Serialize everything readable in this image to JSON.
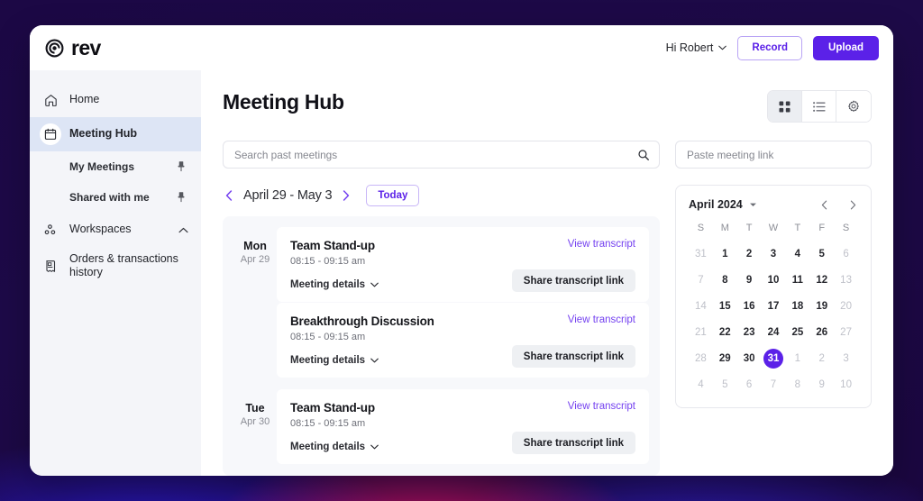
{
  "brand": {
    "name": "rev",
    "logo_icon": "rev-spiral-icon"
  },
  "topbar": {
    "greeting": "Hi Robert",
    "greeting_chevron_icon": "chevron-down-icon",
    "record_label": "Record",
    "upload_label": "Upload",
    "accent_color": "#5b21e8"
  },
  "sidebar": {
    "items": [
      {
        "label": "Home",
        "icon": "home-icon",
        "active": false
      },
      {
        "label": "Meeting Hub",
        "icon": "calendar-icon",
        "active": true
      },
      {
        "label": "Workspaces",
        "icon": "workspaces-dots-icon",
        "active": false,
        "chevron": "chevron-up-icon"
      },
      {
        "label": "Orders & transactions history",
        "icon": "receipt-icon",
        "active": false
      }
    ],
    "sub_items": [
      {
        "label": "My Meetings",
        "pin_icon": "pin-icon"
      },
      {
        "label": "Shared with me",
        "pin_icon": "pin-icon"
      }
    ]
  },
  "main": {
    "page_title": "Meeting Hub",
    "view_toggle": [
      {
        "name": "grid-view",
        "icon": "grid-icon",
        "active": true
      },
      {
        "name": "list-view",
        "icon": "list-icon",
        "active": false
      },
      {
        "name": "settings",
        "icon": "gear-icon",
        "active": false
      }
    ],
    "search": {
      "value": "",
      "placeholder": "Search past meetings",
      "icon": "search-icon"
    },
    "paste_link": {
      "value": "",
      "placeholder": "Paste meeting link"
    },
    "date_nav": {
      "prev_icon": "chevron-left-icon",
      "next_icon": "chevron-right-icon",
      "range": "April 29 - May 3",
      "today_label": "Today"
    },
    "day_groups": [
      {
        "dow": "Mon",
        "date": "Apr 29",
        "meetings": [
          {
            "title": "Team Stand-up",
            "time": "08:15 -  09:15 am",
            "details_label": "Meeting details",
            "details_chevron_icon": "chevron-down-icon",
            "view_transcript_label": "View transcript",
            "share_label": "Share transcript link"
          },
          {
            "title": "Breakthrough Discussion",
            "time": "08:15 -  09:15 am",
            "details_label": "Meeting details",
            "details_chevron_icon": "chevron-down-icon",
            "view_transcript_label": "View transcript",
            "share_label": "Share transcript link"
          }
        ]
      },
      {
        "dow": "Tue",
        "date": "Apr 30",
        "meetings": [
          {
            "title": "Team Stand-up",
            "time": "08:15 -  09:15 am",
            "details_label": "Meeting details",
            "details_chevron_icon": "chevron-down-icon",
            "view_transcript_label": "View transcript",
            "share_label": "Share transcript link"
          }
        ]
      }
    ]
  },
  "calendar": {
    "month": "April 2024",
    "month_caret_icon": "caret-down-icon",
    "prev_icon": "chevron-left-icon",
    "next_icon": "chevron-right-icon",
    "dow_headers": [
      "S",
      "M",
      "T",
      "W",
      "T",
      "F",
      "S"
    ],
    "selected_day": 31,
    "selected_color": "#5b21e8",
    "weeks": [
      [
        {
          "d": "31",
          "muted": true
        },
        {
          "d": "1",
          "muted": false
        },
        {
          "d": "2",
          "muted": false
        },
        {
          "d": "3",
          "muted": false
        },
        {
          "d": "4",
          "muted": false
        },
        {
          "d": "5",
          "muted": false
        },
        {
          "d": "6",
          "muted": true
        }
      ],
      [
        {
          "d": "7",
          "muted": true
        },
        {
          "d": "8",
          "muted": false
        },
        {
          "d": "9",
          "muted": false
        },
        {
          "d": "10",
          "muted": false
        },
        {
          "d": "11",
          "muted": false
        },
        {
          "d": "12",
          "muted": false
        },
        {
          "d": "13",
          "muted": true
        }
      ],
      [
        {
          "d": "14",
          "muted": true
        },
        {
          "d": "15",
          "muted": false
        },
        {
          "d": "16",
          "muted": false
        },
        {
          "d": "17",
          "muted": false
        },
        {
          "d": "18",
          "muted": false
        },
        {
          "d": "19",
          "muted": false
        },
        {
          "d": "20",
          "muted": true
        }
      ],
      [
        {
          "d": "21",
          "muted": true
        },
        {
          "d": "22",
          "muted": false
        },
        {
          "d": "23",
          "muted": false
        },
        {
          "d": "24",
          "muted": false
        },
        {
          "d": "25",
          "muted": false
        },
        {
          "d": "26",
          "muted": false
        },
        {
          "d": "27",
          "muted": true
        }
      ],
      [
        {
          "d": "28",
          "muted": true
        },
        {
          "d": "29",
          "muted": false
        },
        {
          "d": "30",
          "muted": false
        },
        {
          "d": "31",
          "muted": false,
          "selected": true
        },
        {
          "d": "1",
          "muted": true
        },
        {
          "d": "2",
          "muted": true
        },
        {
          "d": "3",
          "muted": true
        }
      ],
      [
        {
          "d": "4",
          "muted": true
        },
        {
          "d": "5",
          "muted": true
        },
        {
          "d": "6",
          "muted": true
        },
        {
          "d": "7",
          "muted": true
        },
        {
          "d": "8",
          "muted": true
        },
        {
          "d": "9",
          "muted": true
        },
        {
          "d": "10",
          "muted": true
        }
      ]
    ]
  }
}
